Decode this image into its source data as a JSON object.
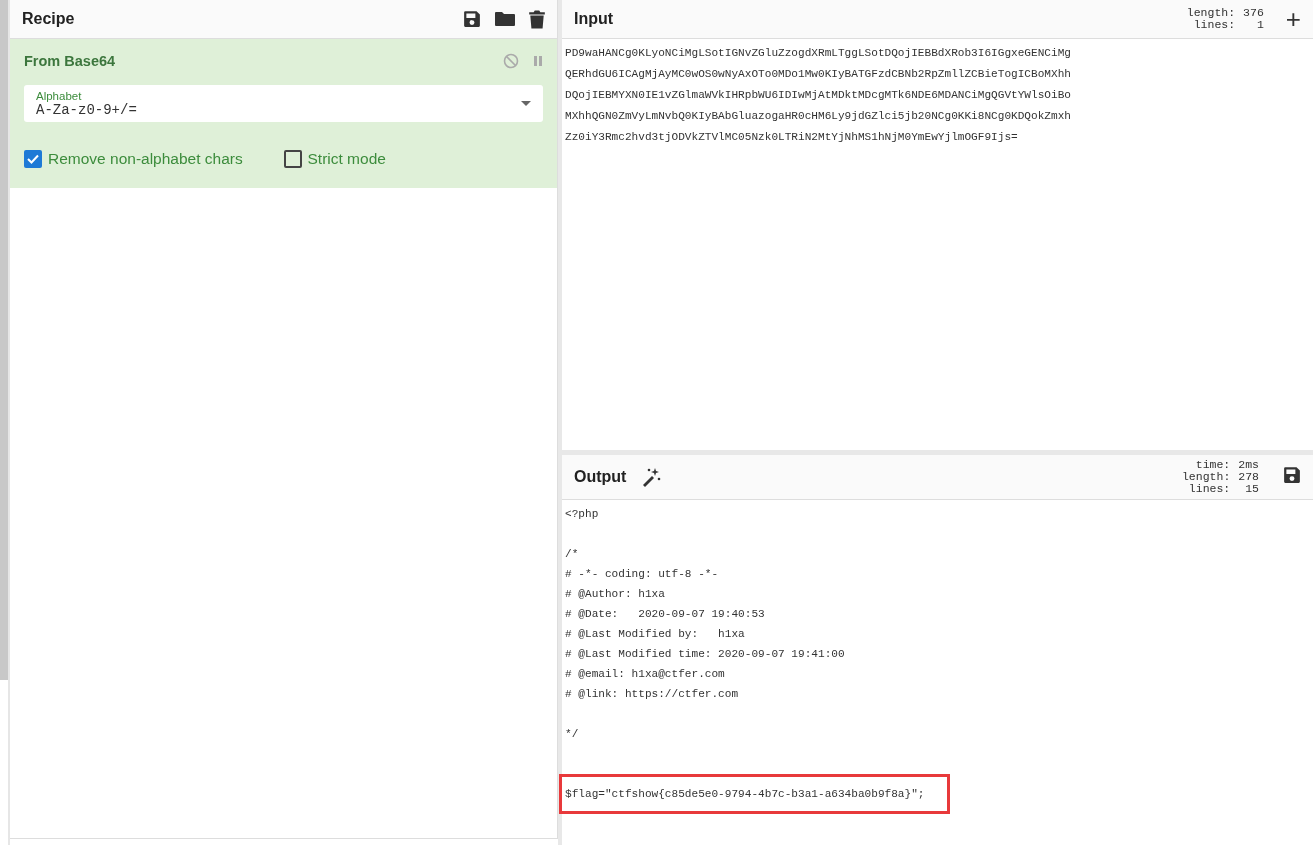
{
  "recipe": {
    "title": "Recipe",
    "operation": {
      "name": "From Base64",
      "disabled": false,
      "paused": false,
      "alphabet": {
        "label": "Alphabet",
        "value": "A-Za-z0-9+/="
      },
      "options": [
        {
          "label": "Remove non-alphabet chars",
          "checked": true
        },
        {
          "label": "Strict mode",
          "checked": false
        }
      ]
    }
  },
  "input": {
    "title": "Input",
    "stats": [
      {
        "label": "length:",
        "value": "376"
      },
      {
        "label": "lines:",
        "value": "1"
      }
    ],
    "add_symbol": "+",
    "lines": [
      "PD9waHANCg0KLyoNCiMgLSotIGNvZGluZzogdXRmLTggLSotDQojIEBBdXRob3I6IGgxeGENCiMg",
      "QERhdGU6ICAgMjAyMC0wOS0wNyAxOTo0MDo1Mw0KIyBATGFzdCBNb2RpZmllZCBieTogICBoMXhh",
      "DQojIEBMYXN0IE1vZGlmaWVkIHRpbWU6IDIwMjAtMDktMDcgMTk6NDE6MDANCiMgQGVtYWlsOiBo",
      "MXhhQGN0ZmVyLmNvbQ0KIyBAbGluazogaHR0cHM6Ly9jdGZlci5jb20NCg0KKi8NCg0KDQokZmxh",
      "Zz0iY3Rmc2hvd3tjODVkZTVlMC05Nzk0LTRiN2MtYjNhMS1hNjM0YmEwYjlmOGF9Ijs="
    ]
  },
  "output": {
    "title": "Output",
    "stats": [
      {
        "label": "time:",
        "value": "2ms"
      },
      {
        "label": "length:",
        "value": "278"
      },
      {
        "label": "lines:",
        "value": "15"
      }
    ],
    "lines": [
      {
        "kind": "text",
        "text": "<?php",
        "highlighted": false
      },
      {
        "kind": "blank"
      },
      {
        "kind": "text",
        "text": "/*",
        "highlighted": false
      },
      {
        "kind": "text",
        "text": "# -*- coding: utf-8 -*-",
        "highlighted": false
      },
      {
        "kind": "text",
        "text": "# @Author: h1xa",
        "highlighted": false
      },
      {
        "kind": "text",
        "text": "# @Date:   2020-09-07 19:40:53",
        "highlighted": false
      },
      {
        "kind": "text",
        "text": "# @Last Modified by:   h1xa",
        "highlighted": false
      },
      {
        "kind": "text",
        "text": "# @Last Modified time: 2020-09-07 19:41:00",
        "highlighted": false
      },
      {
        "kind": "text",
        "text": "# @email: h1xa@ctfer.com",
        "highlighted": false
      },
      {
        "kind": "text",
        "text": "# @link: https://ctfer.com",
        "highlighted": false
      },
      {
        "kind": "blank"
      },
      {
        "kind": "text",
        "text": "*/",
        "highlighted": false
      },
      {
        "kind": "blank"
      },
      {
        "kind": "blank"
      },
      {
        "kind": "text",
        "text": "$flag=\"ctfshow{c85de5e0-9794-4b7c-b3a1-a634ba0b9f8a}\";",
        "highlighted": true
      }
    ]
  }
}
